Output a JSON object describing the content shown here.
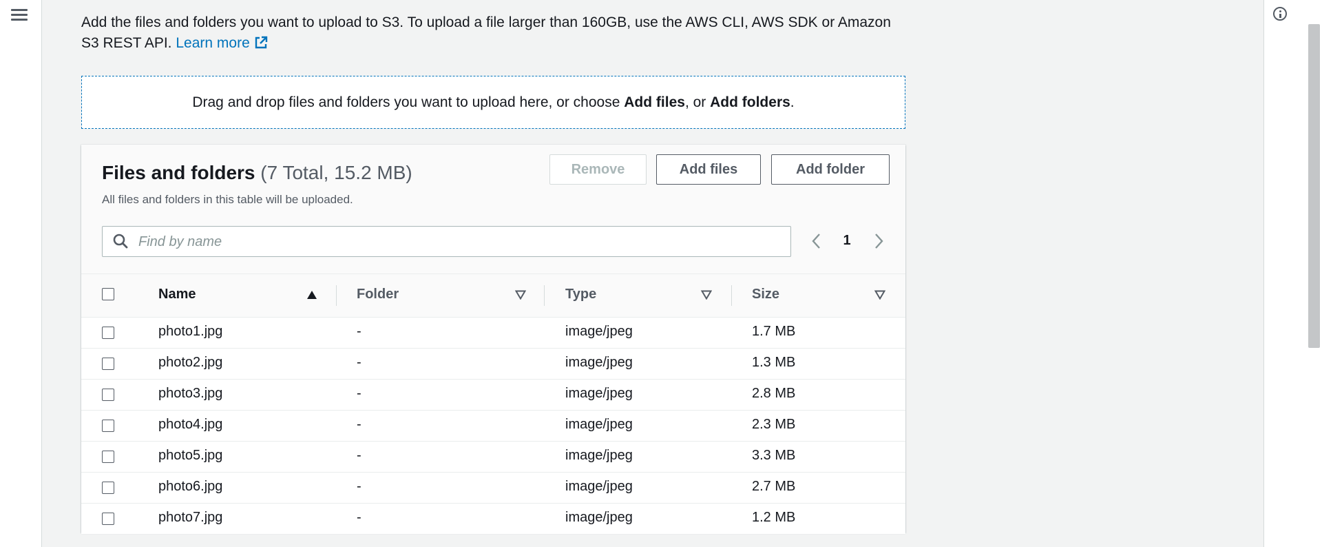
{
  "intro": {
    "text": "Add the files and folders you want to upload to S3. To upload a file larger than 160GB, use the AWS CLI, AWS SDK or Amazon S3 REST API.",
    "learn_more": "Learn more"
  },
  "dropzone": {
    "prefix": "Drag and drop files and folders you want to upload here, or choose ",
    "add_files": "Add files",
    "middle": ", or ",
    "add_folders": "Add folders",
    "suffix": "."
  },
  "panel": {
    "title": "Files and folders",
    "count": "(7 Total, 15.2 MB)",
    "description": "All files and folders in this table will be uploaded.",
    "buttons": {
      "remove": "Remove",
      "add_files": "Add files",
      "add_folder": "Add folder"
    },
    "search": {
      "placeholder": "Find by name",
      "value": ""
    },
    "pagination": {
      "current_page": "1"
    },
    "columns": [
      "Name",
      "Folder",
      "Type",
      "Size"
    ],
    "rows": [
      {
        "name": "photo1.jpg",
        "folder": "-",
        "type": "image/jpeg",
        "size": "1.7 MB"
      },
      {
        "name": "photo2.jpg",
        "folder": "-",
        "type": "image/jpeg",
        "size": "1.3 MB"
      },
      {
        "name": "photo3.jpg",
        "folder": "-",
        "type": "image/jpeg",
        "size": "2.8 MB"
      },
      {
        "name": "photo4.jpg",
        "folder": "-",
        "type": "image/jpeg",
        "size": "2.3 MB"
      },
      {
        "name": "photo5.jpg",
        "folder": "-",
        "type": "image/jpeg",
        "size": "3.3 MB"
      },
      {
        "name": "photo6.jpg",
        "folder": "-",
        "type": "image/jpeg",
        "size": "2.7 MB"
      },
      {
        "name": "photo7.jpg",
        "folder": "-",
        "type": "image/jpeg",
        "size": "1.2 MB"
      }
    ]
  },
  "icons": {
    "menu": "hamburger-menu-icon",
    "info": "info-icon",
    "external_link": "external-link-icon",
    "search": "search-icon",
    "prev": "chevron-left-icon",
    "next": "chevron-right-icon",
    "sort_asc": "sort-ascending-icon",
    "sort_none": "sort-descending-icon"
  },
  "colors": {
    "link": "#0073bb",
    "background": "#f2f3f3",
    "text": "#16191f",
    "muted": "#545b64",
    "border": "#eaeded"
  }
}
